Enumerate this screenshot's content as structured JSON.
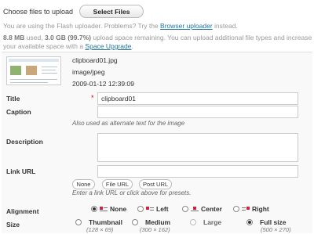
{
  "header": {
    "choose_label": "Choose files to upload",
    "select_button": "Select Files",
    "flash_text_before": "You are using the Flash uploader.  Problems?  Try the ",
    "browser_uploader_link": "Browser uploader",
    "flash_text_after": " instead."
  },
  "space": {
    "used": "8.8 MB",
    "used_label": " used, ",
    "remaining": "3.0 GB (99.7%)",
    "remaining_label": " upload space remaining. You can upload additional file types and increase your available space with a ",
    "upgrade_link": "Space Upgrade",
    "end": "."
  },
  "file": {
    "name": "clipboard01.jpg",
    "mime": "image/jpeg",
    "date": "2009-01-12 12:39:09"
  },
  "form": {
    "title_label": "Title",
    "required_mark": "*",
    "title_value": "clipboard01",
    "caption_label": "Caption",
    "caption_help": "Also used as alternate text for the image",
    "description_label": "Description",
    "link_label": "Link URL",
    "link_buttons": [
      "None",
      "File URL",
      "Post URL"
    ],
    "link_help": "Enter a link URL or click above for presets.",
    "alignment_label": "Alignment",
    "alignment_options": [
      "None",
      "Left",
      "Center",
      "Right"
    ],
    "alignment_selected": "None",
    "size_label": "Size",
    "size_options": [
      {
        "label": "Thumbnail",
        "dims": "(128 × 69)"
      },
      {
        "label": "Medium",
        "dims": "(300 × 162)"
      },
      {
        "label": "Large",
        "dims": ""
      },
      {
        "label": "Full size",
        "dims": "(500 × 270)"
      }
    ],
    "size_selected": "Full size"
  }
}
